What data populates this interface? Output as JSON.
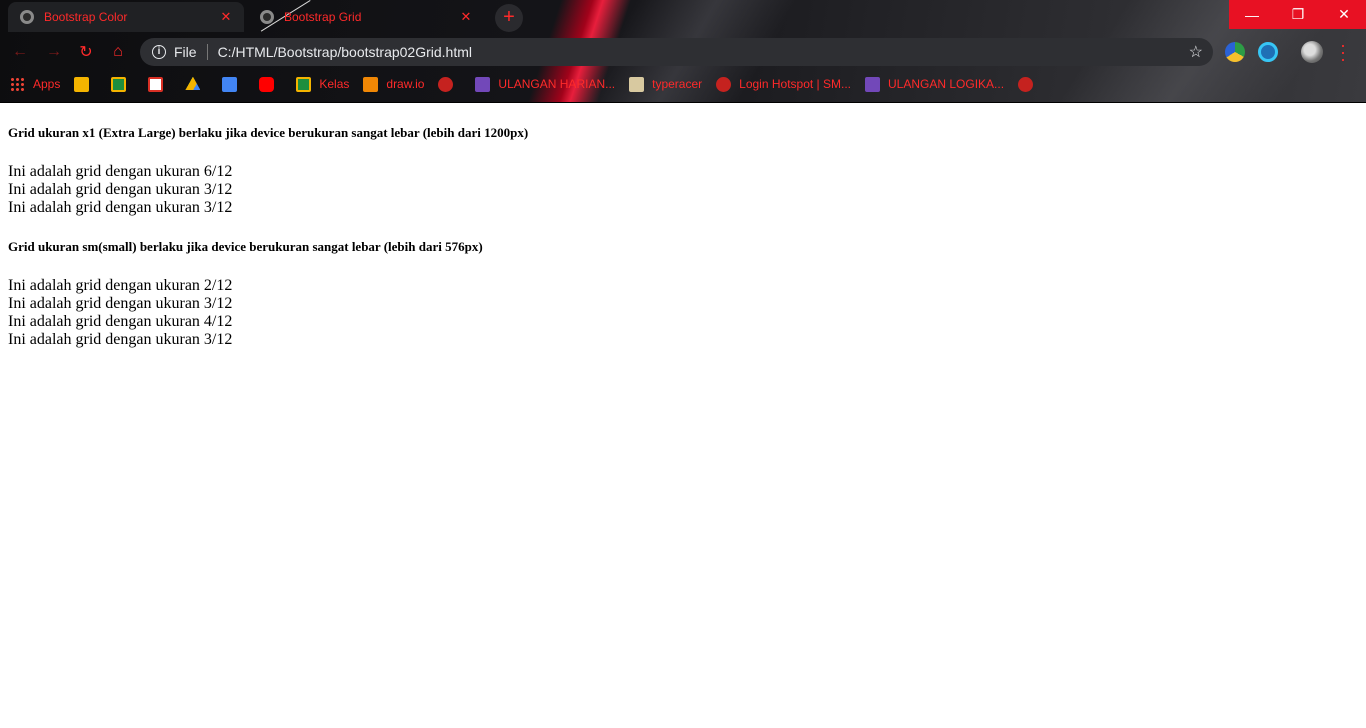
{
  "browser": {
    "tabs": [
      {
        "title": "Bootstrap Color",
        "active": true
      },
      {
        "title": "Bootstrap Grid",
        "active": false
      }
    ],
    "new_tab_icon": "plus-icon",
    "window_controls": {
      "minimize": "—",
      "maximize": "❐",
      "close": "✕"
    },
    "address_bar": {
      "scheme_label": "File",
      "url": "C:/HTML/Bootstrap/bootstrap02Grid.html"
    },
    "accent_color": "#ff2a2a",
    "close_button_color": "#e81123"
  },
  "bookmarks": [
    {
      "label": "Apps",
      "icon": "apps-icon"
    },
    {
      "label": "",
      "icon": "slides-icon"
    },
    {
      "label": "",
      "icon": "classroom-icon"
    },
    {
      "label": "",
      "icon": "gmail-icon"
    },
    {
      "label": "",
      "icon": "drive-icon"
    },
    {
      "label": "",
      "icon": "docs-icon"
    },
    {
      "label": "",
      "icon": "youtube-icon"
    },
    {
      "label": "Kelas",
      "icon": "classroom-icon"
    },
    {
      "label": "draw.io",
      "icon": "drawio-icon"
    },
    {
      "label": "",
      "icon": "globe-icon"
    },
    {
      "label": "ULANGAN HARIAN...",
      "icon": "forms-icon"
    },
    {
      "label": "typeracer",
      "icon": "typeracer-icon"
    },
    {
      "label": "Login Hotspot | SM...",
      "icon": "globe-icon"
    },
    {
      "label": "ULANGAN LOGIKA...",
      "icon": "forms-icon"
    },
    {
      "label": "",
      "icon": "globe-icon"
    }
  ],
  "page": {
    "sections": [
      {
        "heading": "Grid ukuran x1 (Extra Large) berlaku jika device berukuran sangat lebar (lebih dari 1200px)",
        "items": [
          "Ini adalah grid dengan ukuran 6/12",
          "Ini adalah grid dengan ukuran 3/12",
          "Ini adalah grid dengan ukuran 3/12"
        ]
      },
      {
        "heading": "Grid ukuran sm(small) berlaku jika device berukuran sangat lebar (lebih dari 576px)",
        "items": [
          "Ini adalah grid dengan ukuran 2/12",
          "Ini adalah grid dengan ukuran 3/12",
          "Ini adalah grid dengan ukuran 4/12",
          "Ini adalah grid dengan ukuran 3/12"
        ]
      }
    ]
  }
}
